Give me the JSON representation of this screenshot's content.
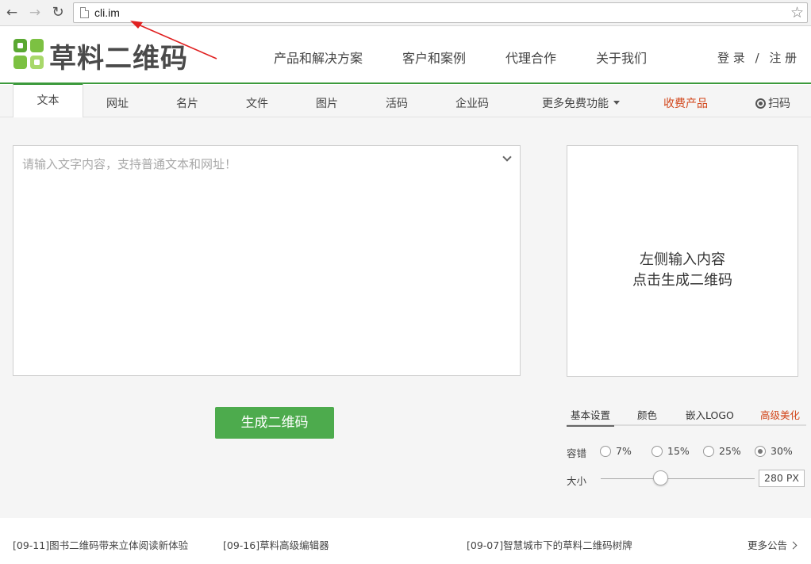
{
  "browser": {
    "url": "cli.im"
  },
  "header": {
    "logo_text": "草料二维码",
    "nav": [
      "产品和解决方案",
      "客户和案例",
      "代理合作",
      "关于我们"
    ],
    "login": "登 录",
    "separator": "/",
    "register": "注 册"
  },
  "tabs": {
    "text": "文本",
    "url": "网址",
    "card": "名片",
    "file": "文件",
    "image": "图片",
    "live": "活码",
    "enterprise": "企业码",
    "more": "更多免费功能",
    "paid": "收费产品",
    "scan": "扫码"
  },
  "editor": {
    "placeholder": "请输入文字内容，支持普通文本和网址！",
    "generate_label": "生成二维码"
  },
  "preview": {
    "line1": "左侧输入内容",
    "line2": "点击生成二维码"
  },
  "settings": {
    "tabs": [
      "基本设置",
      "颜色",
      "嵌入LOGO",
      "高级美化"
    ],
    "error_label": "容错",
    "error_options": [
      "7%",
      "15%",
      "25%",
      "30%"
    ],
    "error_selected": "30%",
    "size_label": "大小",
    "size_value": "280 PX",
    "size_slider_fraction": 0.39
  },
  "notices": {
    "items": [
      "[09-11]图书二维码带来立体阅读新体验",
      "[09-16]草料高级编辑器",
      "[09-07]智慧城市下的草料二维码树牌"
    ],
    "more": "更多公告"
  },
  "colors": {
    "brand_green": "#3c9a3c",
    "button_green": "#4dab4d",
    "accent_orange": "#d2471c",
    "annotation_red": "#e02020"
  }
}
